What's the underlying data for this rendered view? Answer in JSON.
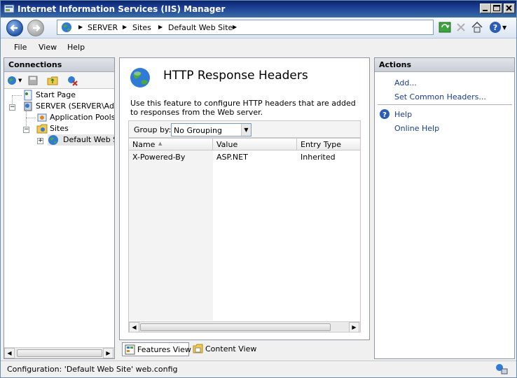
{
  "window": {
    "title": "Internet Information Services (IIS) Manager",
    "accent": "#0a246a"
  },
  "address": {
    "crumbs": [
      "SERVER",
      "Sites",
      "Default Web Site"
    ]
  },
  "menu": {
    "file": "File",
    "view": "View",
    "help": "Help"
  },
  "connections": {
    "title": "Connections",
    "tree": {
      "start_page": "Start Page",
      "server": "SERVER (SERVER\\Admin",
      "app_pools": "Application Pools",
      "sites": "Sites",
      "default_site": "Default Web Sit"
    }
  },
  "feature": {
    "title": "HTTP Response Headers",
    "description": "Use this feature to configure HTTP headers that are added to responses from the Web server.",
    "group_by_label": "Group by:",
    "group_by_value": "No Grouping",
    "columns": [
      "Name",
      "Value",
      "Entry Type"
    ],
    "rows": [
      {
        "name": "X-Powered-By",
        "value": "ASP.NET",
        "entry_type": "Inherited"
      }
    ]
  },
  "view_tabs": {
    "features": "Features View",
    "content": "Content View"
  },
  "actions": {
    "title": "Actions",
    "add": "Add...",
    "set_common": "Set Common Headers...",
    "help": "Help",
    "online_help": "Online Help"
  },
  "status": {
    "text": "Configuration: 'Default Web Site' web.config"
  },
  "icons": {
    "app": "iis-app-icon",
    "globe": "globe-icon",
    "help": "help-icon"
  }
}
